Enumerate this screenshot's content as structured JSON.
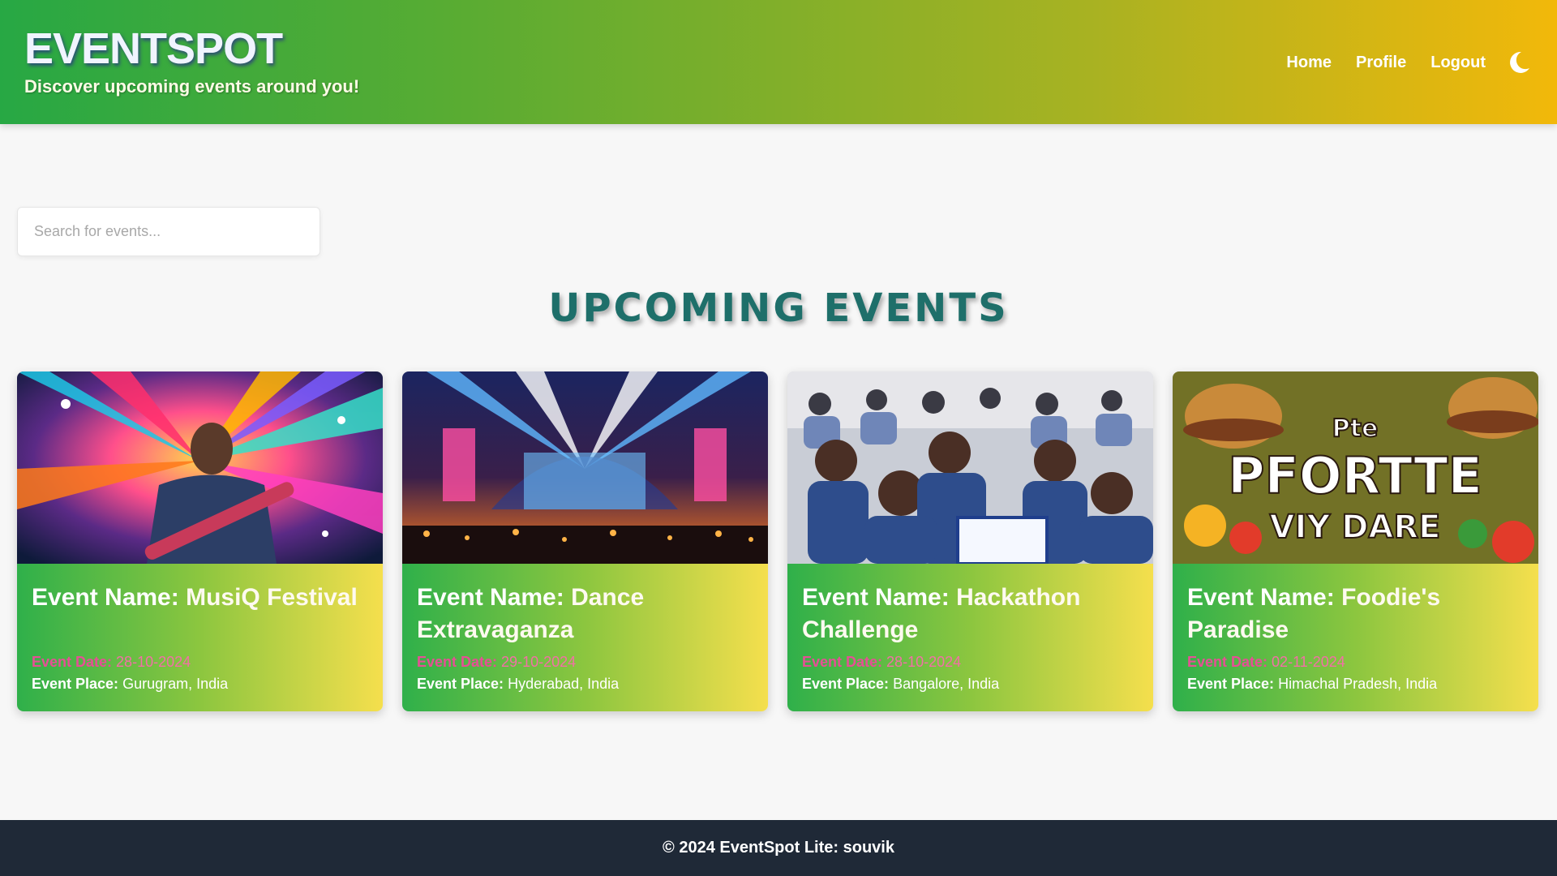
{
  "header": {
    "title": "EVENTSPOT",
    "subtitle": "Discover upcoming events around you!",
    "nav": {
      "home": "Home",
      "profile": "Profile",
      "logout": "Logout"
    },
    "theme_toggle_icon": "moon-icon"
  },
  "search": {
    "placeholder": "Search for events...",
    "value": ""
  },
  "section_title": "UPCOMING EVENTS",
  "labels": {
    "name": "Event Name:",
    "date": "Event Date:",
    "place": "Event Place:"
  },
  "events": [
    {
      "name": "MusiQ Festival",
      "date": "28-10-2024",
      "place": "Gurugram, India",
      "image": "guitarist-concert"
    },
    {
      "name": "Dance Extravaganza",
      "date": "29-10-2024",
      "place": "Hyderabad, India",
      "image": "concert-stage"
    },
    {
      "name": "Hackathon Challenge",
      "date": "28-10-2024",
      "place": "Bangalore, India",
      "image": "hackathon-crowd"
    },
    {
      "name": "Foodie's Paradise",
      "date": "02-11-2024",
      "place": "Himachal Pradesh, India",
      "image": "food-poster",
      "image_text": [
        "Pte",
        "PFORTTE",
        "VIY DARE"
      ]
    }
  ],
  "footer": {
    "text": "© 2024 EventSpot Lite: souvik"
  },
  "colors": {
    "header_start": "#27a844",
    "header_end": "#f2b80a",
    "card_start": "#2fb04a",
    "card_end": "#f5df4d",
    "date_pink": "#e64f95",
    "title_teal": "#1e6f6a",
    "footer_bg": "#1f2937"
  }
}
